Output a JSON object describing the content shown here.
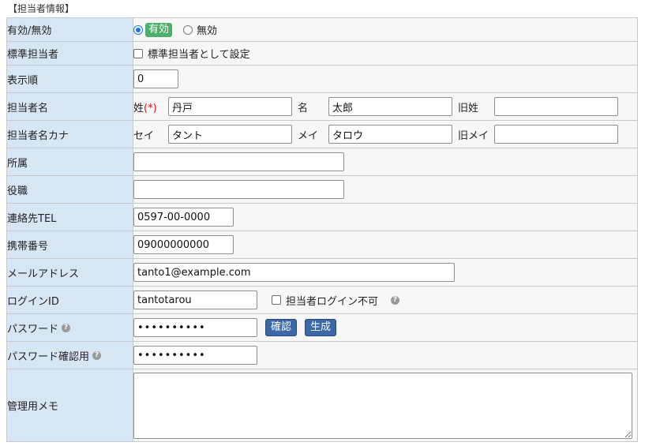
{
  "section": {
    "title": "【担当者情報】"
  },
  "rows": {
    "valid": {
      "label": "有効/無効",
      "opt_on": "有効",
      "opt_off": "無効",
      "selected": "有効"
    },
    "standard": {
      "label": "標準担当者",
      "checkbox_label": "標準担当者として設定",
      "checked": false
    },
    "order": {
      "label": "表示順",
      "value": "0"
    },
    "name": {
      "label": "担当者名",
      "sei_label": "姓",
      "required_mark": "(*)",
      "sei_value": "丹戸",
      "mei_label": "名",
      "mei_value": "太郎",
      "old_sei_label": "旧姓",
      "old_sei_value": ""
    },
    "kana": {
      "label": "担当者名カナ",
      "sei_label": "セイ",
      "sei_value": "タント",
      "mei_label": "メイ",
      "mei_value": "タロウ",
      "old_mei_label": "旧メイ",
      "old_mei_value": ""
    },
    "affiliation": {
      "label": "所属",
      "value": ""
    },
    "position": {
      "label": "役職",
      "value": ""
    },
    "tel": {
      "label": "連絡先TEL",
      "value": "0597-00-0000"
    },
    "mobile": {
      "label": "携帯番号",
      "value": "09000000000"
    },
    "email": {
      "label": "メールアドレス",
      "value": "tanto1@example.com"
    },
    "login": {
      "label": "ログインID",
      "value": "tantotarou",
      "checkbox_label": "担当者ログイン不可",
      "checked": false
    },
    "password": {
      "label": "パスワード",
      "value": "••••••••••",
      "confirm_button": "確認",
      "generate_button": "生成"
    },
    "password_confirm": {
      "label": "パスワード確認用",
      "value": "••••••••••"
    },
    "memo": {
      "label": "管理用メモ",
      "value": ""
    }
  },
  "colors": {
    "label_bg": "#d6e6f5",
    "value_bg": "#f7f7f7",
    "button_blue": "#3c68a8",
    "pill_green": "#4caf6a",
    "required_red": "#dd1111"
  }
}
